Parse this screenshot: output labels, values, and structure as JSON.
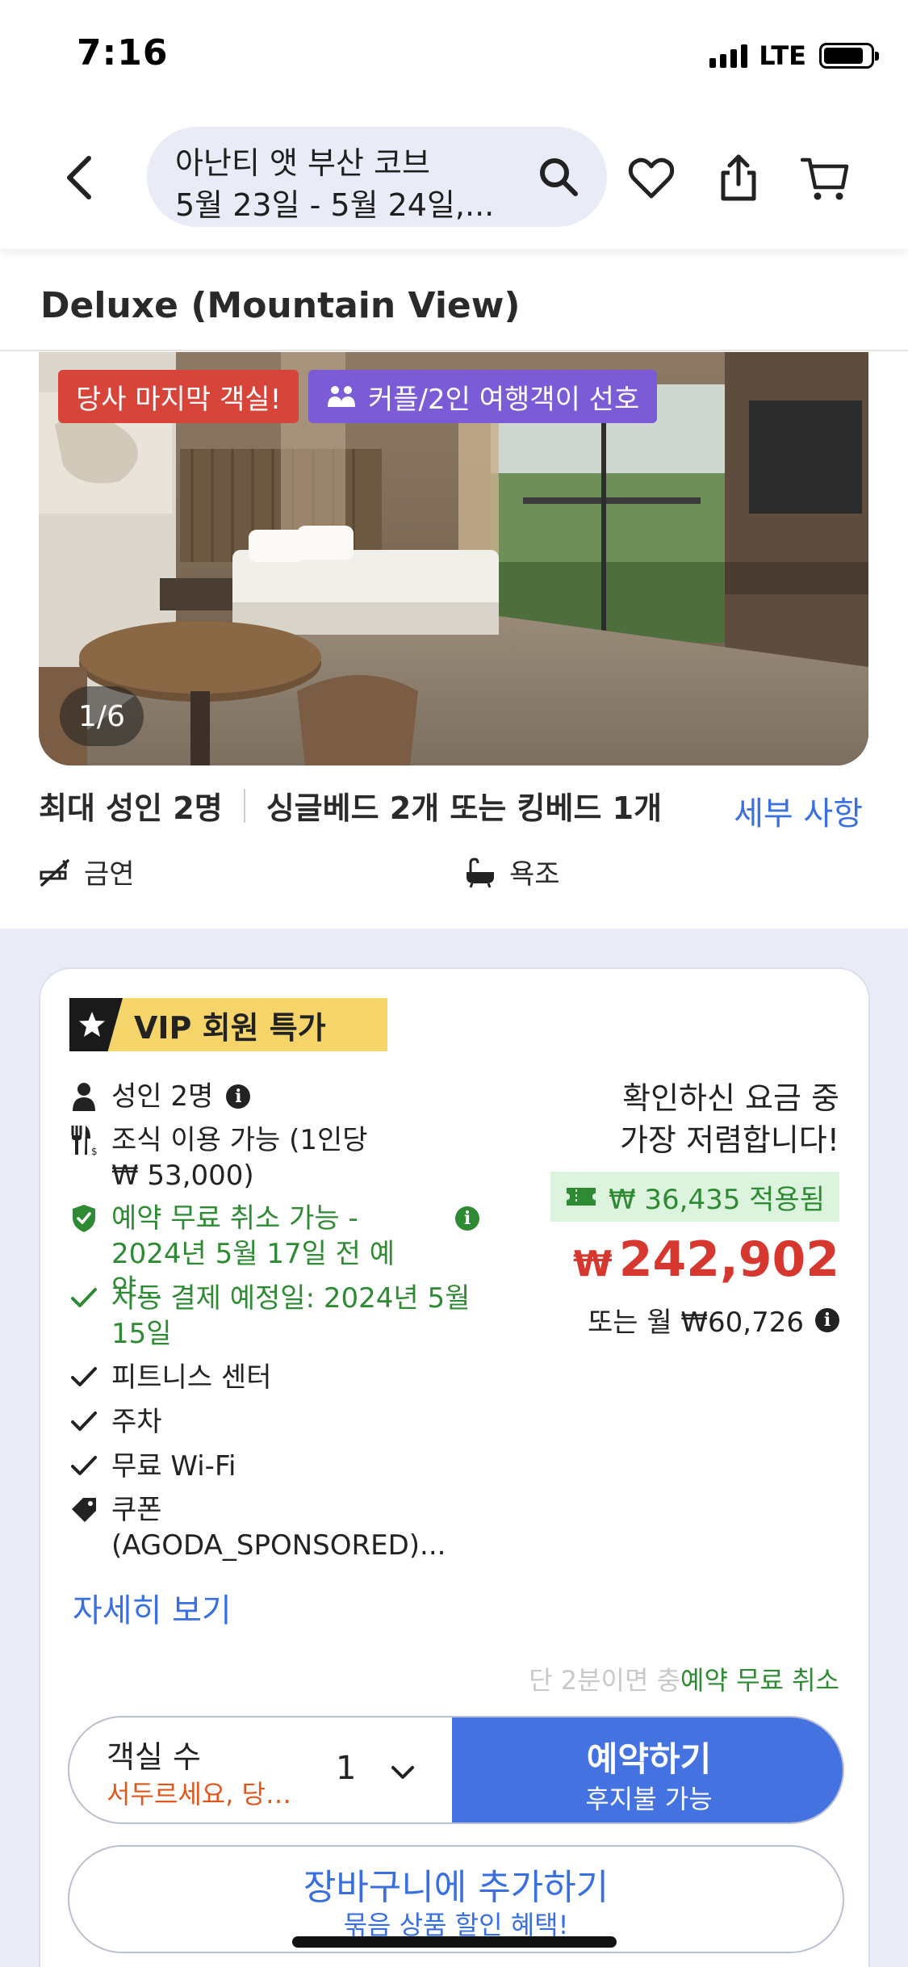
{
  "status_bar": {
    "time": "7:16",
    "network": "LTE",
    "battery_level": 0.85
  },
  "header": {
    "search_title": "아난티 앳 부산 코브",
    "search_dates": "5월 23일 - 5월 24일,..."
  },
  "room": {
    "title": "Deluxe (Mountain View)",
    "badge_last_room": "당사 마지막 객실!",
    "badge_couple": "커플/2인 여행객이 선호",
    "photo_counter": "1/6",
    "max_guests": "최대 성인 2명",
    "beds": "싱글베드 2개 또는 킹베드 1개",
    "details_link": "세부 사항",
    "amenity_nosmoking": "금연",
    "amenity_bathtub": "욕조"
  },
  "offer": {
    "vip_label": "VIP 회원 특가",
    "adults": "성인 2명",
    "breakfast_line1": "조식 이용 가능 (1인당",
    "breakfast_line2": "₩ 53,000)",
    "free_cancel_line1": "예약 무료 취소 가능 -",
    "free_cancel_line2": "2024년 5월 17일 전 예약...",
    "auto_pay_line1": "자동 결제 예정일: 2024년 5월",
    "auto_pay_line2": "15일",
    "fitness": "피트니스 센터",
    "parking": "주차",
    "wifi": "무료 Wi-Fi",
    "coupon_line1": "쿠폰",
    "coupon_line2": "(AGODA_SPONSORED)...",
    "more_link": "자세히 보기",
    "cheapest_line1": "확인하신 요금 중",
    "cheapest_line2": "가장 저렴합니다!",
    "discount_applied": "₩ 36,435 적용됨",
    "price_currency": "₩",
    "price_amount": "242,902",
    "monthly": "또는 월 ₩60,726",
    "ticker_faded": "단 2분이면 충",
    "ticker_green": "예약 무료 취소"
  },
  "booking": {
    "rooms_label": "객실 수",
    "rooms_hurry": "서두르세요, 당신이 찾는 객실이 얼마 남지 않았어요",
    "rooms_count": "1",
    "book_label": "예약하기",
    "book_sub": "후지불 가능",
    "cart_label": "장바구니에 추가하기",
    "cart_sub": "묶음 상품 할인 혜택!"
  },
  "colors": {
    "accent_blue": "#4472e0",
    "price_red": "#d6372e",
    "green": "#2e8a33",
    "vip_yellow": "#f5d56a"
  }
}
